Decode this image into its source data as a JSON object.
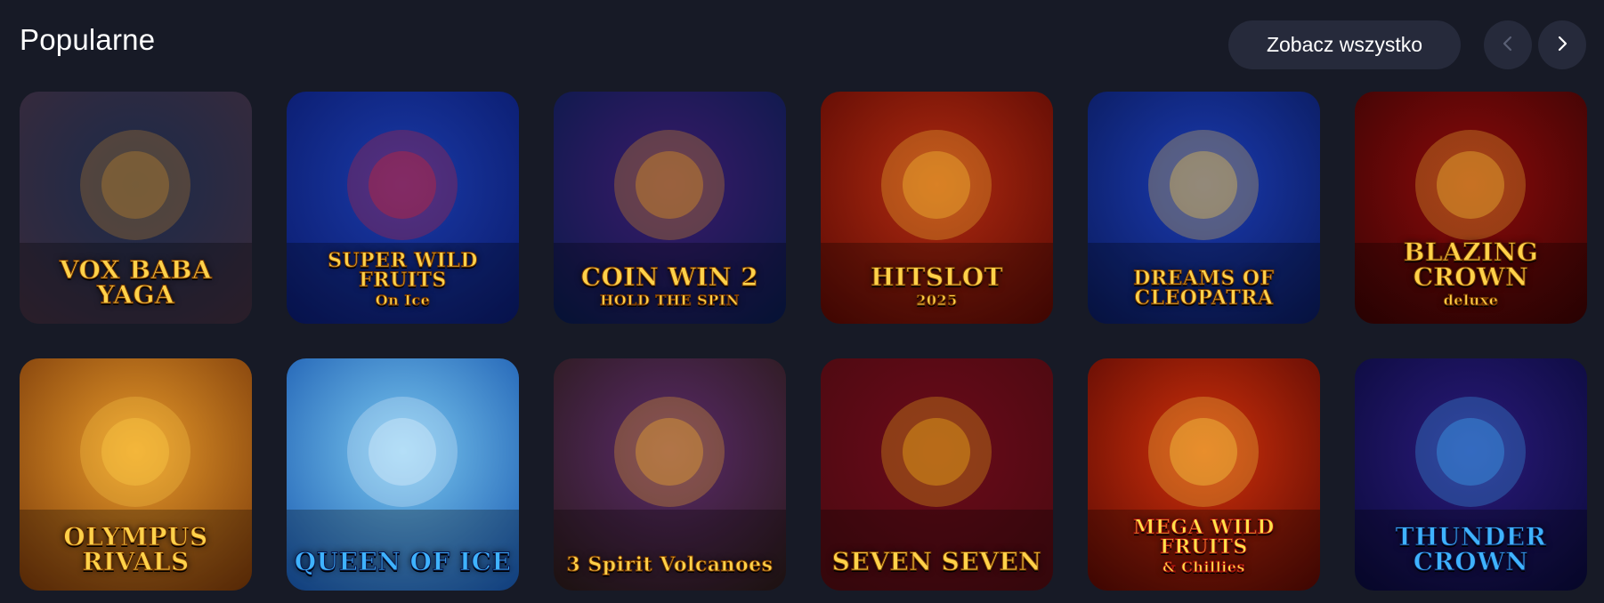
{
  "section": {
    "title": "Popularne",
    "view_all_label": "Zobacz wszystko",
    "prev_icon": "chevron-left-icon",
    "next_icon": "chevron-right-icon"
  },
  "games": [
    {
      "id": "vox-baba-yaga",
      "title": "VOX BABA YAGA",
      "bg": [
        "#1b2a4a",
        "#3a2a3a"
      ],
      "accent": "#c98a2a"
    },
    {
      "id": "super-wild-fruits",
      "title": "SUPER WILD FRUITS",
      "subtitle": "On Ice",
      "bg": [
        "#1a3aa8",
        "#0a1a6a"
      ],
      "accent": "#e0202a"
    },
    {
      "id": "coin-win-2",
      "title": "COIN WIN 2",
      "subtitle": "HOLD THE SPIN",
      "bg": [
        "#3a1a6a",
        "#0a1a4a"
      ],
      "accent": "#f2a01a"
    },
    {
      "id": "hit-slot-2025",
      "title": "HITSLOT",
      "subtitle": "2025",
      "bg": [
        "#b02a10",
        "#5a0a04"
      ],
      "accent": "#ffcf3a"
    },
    {
      "id": "dreams-of-cleopatra",
      "title": "DREAMS OF CLEOPATRA",
      "bg": [
        "#1a3ab0",
        "#0a1a5a"
      ],
      "accent": "#ffd24a"
    },
    {
      "id": "blazing-crown",
      "title": "BLAZING CROWN",
      "subtitle": "deluxe",
      "bg": [
        "#8a0a0a",
        "#3a0404"
      ],
      "accent": "#ffce3a"
    },
    {
      "id": "olympus-rivals",
      "title": "OLYMPUS RIVALS",
      "bg": [
        "#e89a2a",
        "#7a3a0a"
      ],
      "accent": "#ffd24a"
    },
    {
      "id": "queen-of-ice",
      "title": "QUEEN OF ICE",
      "bg": [
        "#7ac8f0",
        "#1a5ab0"
      ],
      "accent": "#e8f4ff"
    },
    {
      "id": "3-spirit-volcanoes",
      "title": "3 Spirit Volcanoes",
      "bg": [
        "#5a2a6a",
        "#2a1a1a"
      ],
      "accent": "#ffb82a"
    },
    {
      "id": "seven-seven-7",
      "title": "SEVEN SEVEN",
      "bg": [
        "#6a0a1a",
        "#4a0a10"
      ],
      "accent": "#ffc21a"
    },
    {
      "id": "mega-wild-fruits-chillies",
      "title": "MEGA WILD FRUITS",
      "subtitle": "& Chillies",
      "bg": [
        "#d0300a",
        "#5a0a04"
      ],
      "accent": "#ffe14a"
    },
    {
      "id": "thunder-crown",
      "title": "THUNDER CROWN",
      "bg": [
        "#2a1a7a",
        "#0a0a3a"
      ],
      "accent": "#3fb3ff"
    }
  ],
  "colors": {
    "background": "#171a26",
    "button_bg": "#262a3b",
    "text": "#ffffff"
  }
}
